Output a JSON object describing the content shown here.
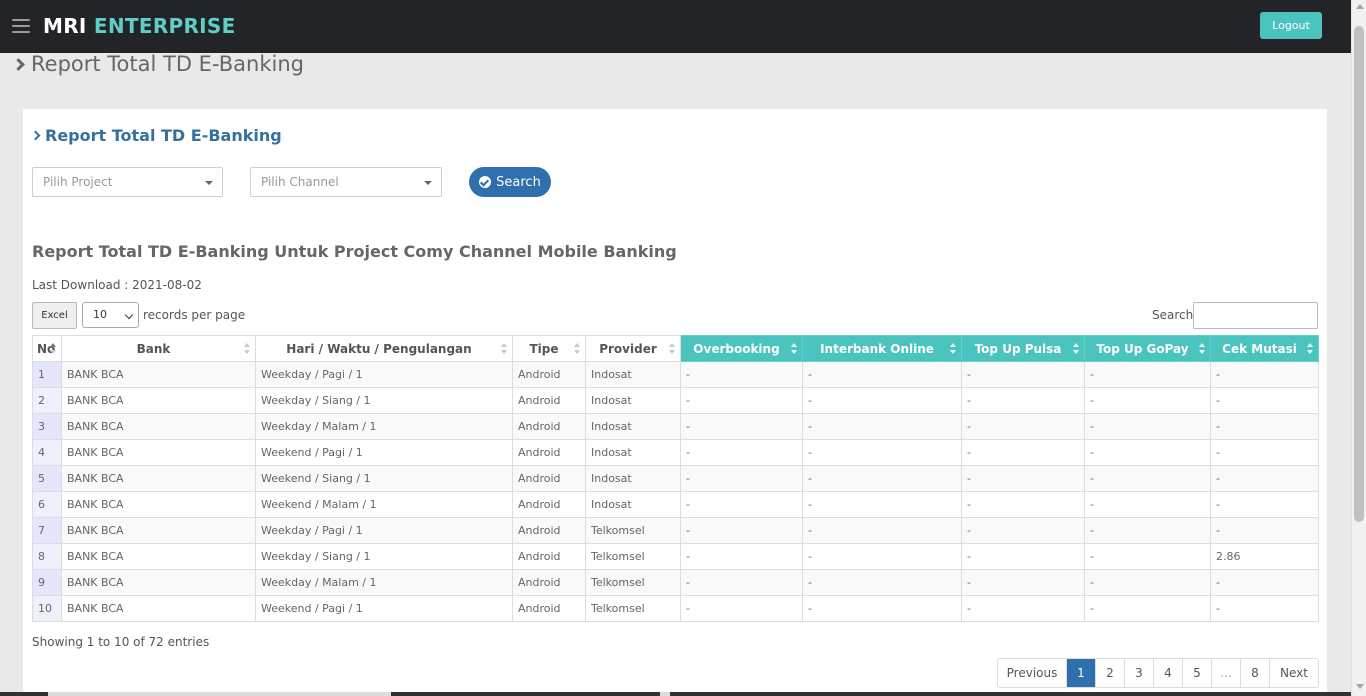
{
  "header": {
    "brand_part1": "MRI",
    "brand_part2": "ENTERPRISE",
    "logout_label": "Logout"
  },
  "page": {
    "title": "Report Total TD E-Banking"
  },
  "panel": {
    "heading": "Report Total TD E-Banking",
    "project_select": "Pilih Project",
    "channel_select": "Pilih Channel",
    "search_button": "Search",
    "report_title": "Report Total TD E-Banking Untuk Project Comy Channel Mobile Banking",
    "last_download": "Last Download : 2021-08-02"
  },
  "table_controls": {
    "excel_label": "Excel",
    "page_length": "10",
    "records_label": "records per page",
    "search_label": "Search:"
  },
  "table": {
    "columns": [
      "No",
      "Bank",
      "Hari / Waktu / Pengulangan",
      "Tipe",
      "Provider",
      "Overbooking",
      "Interbank Online",
      "Top Up Pulsa",
      "Top Up GoPay",
      "Cek Mutasi"
    ],
    "rows": [
      [
        "1",
        "BANK BCA",
        "Weekday / Pagi / 1",
        "Android",
        "Indosat",
        "-",
        "-",
        "-",
        "-",
        "-"
      ],
      [
        "2",
        "BANK BCA",
        "Weekday / Siang / 1",
        "Android",
        "Indosat",
        "-",
        "-",
        "-",
        "-",
        "-"
      ],
      [
        "3",
        "BANK BCA",
        "Weekday / Malam / 1",
        "Android",
        "Indosat",
        "-",
        "-",
        "-",
        "-",
        "-"
      ],
      [
        "4",
        "BANK BCA",
        "Weekend / Pagi / 1",
        "Android",
        "Indosat",
        "-",
        "-",
        "-",
        "-",
        "-"
      ],
      [
        "5",
        "BANK BCA",
        "Weekend / Siang / 1",
        "Android",
        "Indosat",
        "-",
        "-",
        "-",
        "-",
        "-"
      ],
      [
        "6",
        "BANK BCA",
        "Weekend / Malam / 1",
        "Android",
        "Indosat",
        "-",
        "-",
        "-",
        "-",
        "-"
      ],
      [
        "7",
        "BANK BCA",
        "Weekday / Pagi / 1",
        "Android",
        "Telkomsel",
        "-",
        "-",
        "-",
        "-",
        "-"
      ],
      [
        "8",
        "BANK BCA",
        "Weekday / Siang / 1",
        "Android",
        "Telkomsel",
        "-",
        "-",
        "-",
        "-",
        "2.86"
      ],
      [
        "9",
        "BANK BCA",
        "Weekday / Malam / 1",
        "Android",
        "Telkomsel",
        "-",
        "-",
        "-",
        "-",
        "-"
      ],
      [
        "10",
        "BANK BCA",
        "Weekend / Pagi / 1",
        "Android",
        "Telkomsel",
        "-",
        "-",
        "-",
        "-",
        "-"
      ]
    ]
  },
  "footer": {
    "info": "Showing 1 to 10 of 72 entries",
    "pagination": [
      "Previous",
      "1",
      "2",
      "3",
      "4",
      "5",
      "…",
      "8",
      "Next"
    ],
    "active_page": "1"
  },
  "colors": {
    "accent_teal": "#4bc4c0",
    "primary_blue": "#2f6fae",
    "topbar": "#222427"
  }
}
